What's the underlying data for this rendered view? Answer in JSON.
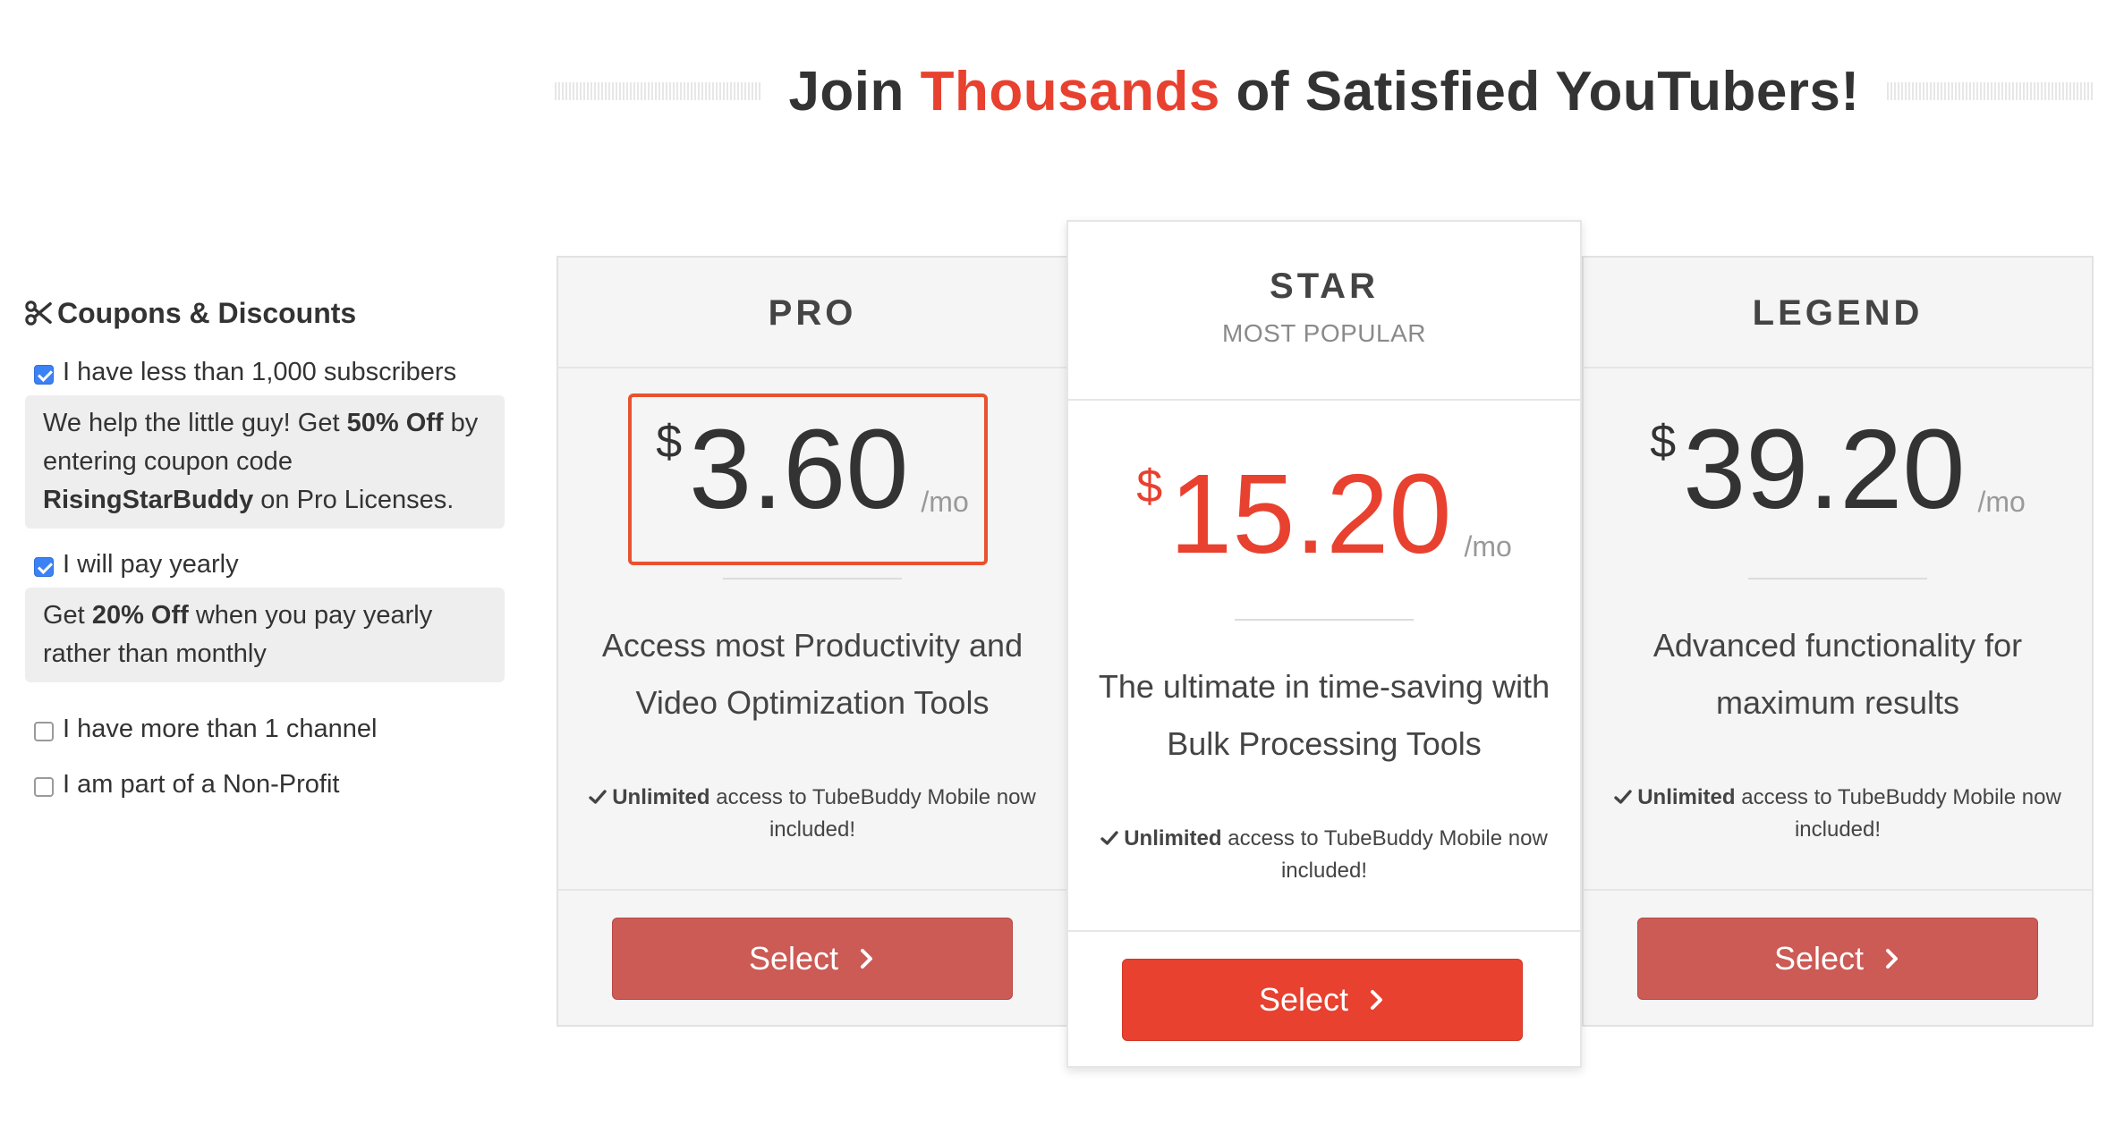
{
  "heading": {
    "prefix": "Join ",
    "accent": "Thousands",
    "suffix": " of Satisfied YouTubers!",
    "accent_color": "#e8412f"
  },
  "coupons": {
    "icon": "scissors-icon",
    "title": "Coupons & Discounts",
    "options": [
      {
        "label": "I have less than 1,000 subscribers",
        "checked": true,
        "note": {
          "part1": "We help the little guy! Get ",
          "bold1": "50% Off",
          "part2": " by entering coupon code ",
          "bold2": "RisingStarBuddy",
          "part3": " on Pro Licenses."
        }
      },
      {
        "label": "I will pay yearly",
        "checked": true,
        "note": {
          "part1": "Get ",
          "bold1": "20% Off",
          "part2": " when you pay yearly rather than monthly"
        }
      },
      {
        "label": "I have more than 1 channel",
        "checked": false
      },
      {
        "label": "I am part of a Non-Profit",
        "checked": false
      }
    ]
  },
  "plans": [
    {
      "name": "PRO",
      "currency": "$",
      "price": "3.60",
      "period": "/mo",
      "description": "Access most Productivity and Video Optimization Tools",
      "mobile_bold": "Unlimited",
      "mobile_text": " access to TubeBuddy Mobile now included!",
      "button": "Select",
      "highlighted_price": true
    },
    {
      "name": "STAR",
      "tag": "MOST POPULAR",
      "currency": "$",
      "price": "15.20",
      "period": "/mo",
      "description": "The ultimate in time-saving with Bulk Processing Tools",
      "mobile_bold": "Unlimited",
      "mobile_text": " access to TubeBuddy Mobile now included!",
      "button": "Select"
    },
    {
      "name": "LEGEND",
      "currency": "$",
      "price": "39.20",
      "period": "/mo",
      "description": "Advanced functionality for maximum results",
      "mobile_bold": "Unlimited",
      "mobile_text": " access to TubeBuddy Mobile now included!",
      "button": "Select"
    }
  ],
  "colors": {
    "primary_red": "#e8412f",
    "muted_red": "#cc5a55",
    "highlight_border": "#e8522f",
    "checkbox_blue": "#3b82f6"
  }
}
